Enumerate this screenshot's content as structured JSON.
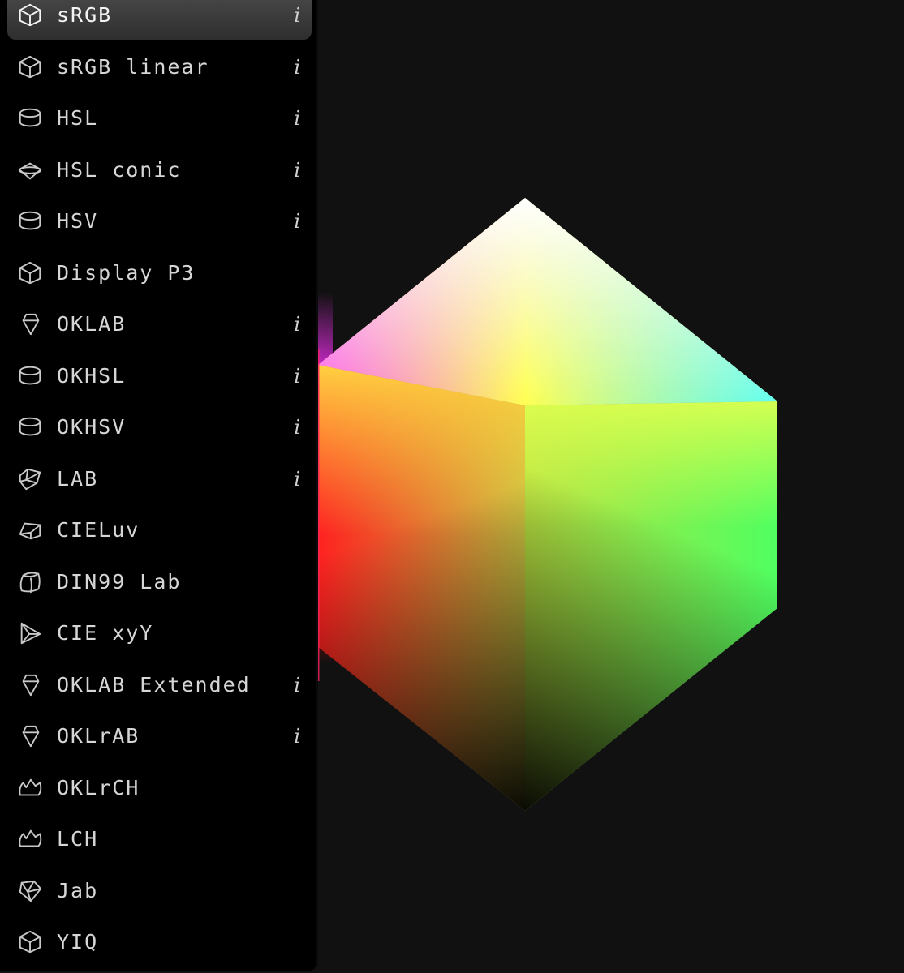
{
  "menu": {
    "items": [
      {
        "label": "sRGB",
        "info": "i",
        "icon": "cube-icon",
        "selected": true
      },
      {
        "label": "sRGB linear",
        "info": "i",
        "icon": "cube-icon",
        "selected": false
      },
      {
        "label": "HSL",
        "info": "i",
        "icon": "cylinder-icon",
        "selected": false
      },
      {
        "label": "HSL conic",
        "info": "i",
        "icon": "bicone-icon",
        "selected": false
      },
      {
        "label": "HSV",
        "info": "i",
        "icon": "cylinder-icon",
        "selected": false
      },
      {
        "label": "Display P3",
        "info": "",
        "icon": "cube-icon",
        "selected": false
      },
      {
        "label": "OKLAB",
        "info": "i",
        "icon": "gem-icon",
        "selected": false
      },
      {
        "label": "OKHSL",
        "info": "i",
        "icon": "cylinder-icon",
        "selected": false
      },
      {
        "label": "OKHSV",
        "info": "i",
        "icon": "cylinder-icon",
        "selected": false
      },
      {
        "label": "LAB",
        "info": "i",
        "icon": "polyhedron-icon",
        "selected": false
      },
      {
        "label": "CIELuv",
        "info": "",
        "icon": "wedge-icon",
        "selected": false
      },
      {
        "label": "DIN99 Lab",
        "info": "",
        "icon": "rounded-cube-icon",
        "selected": false
      },
      {
        "label": "CIE xyY",
        "info": "",
        "icon": "triangle-icon",
        "selected": false
      },
      {
        "label": "OKLAB Extended",
        "info": "i",
        "icon": "gem-icon",
        "selected": false
      },
      {
        "label": "OKLrAB",
        "info": "i",
        "icon": "gem-icon",
        "selected": false
      },
      {
        "label": "OKLrCH",
        "info": "",
        "icon": "crown-icon",
        "selected": false
      },
      {
        "label": "LCH",
        "info": "",
        "icon": "crown-icon",
        "selected": false
      },
      {
        "label": "Jab",
        "info": "",
        "icon": "shield-polyhedron-icon",
        "selected": false
      },
      {
        "label": "YIQ",
        "info": "",
        "icon": "cube-icon",
        "selected": false
      }
    ]
  },
  "colors": {
    "background": "#111111",
    "menu_background": "#000000",
    "selected_background": "#3c3c3c",
    "text": "#d6d6d6"
  }
}
